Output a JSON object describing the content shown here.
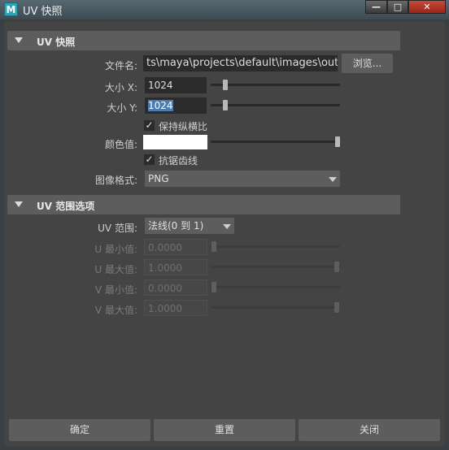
{
  "window": {
    "title": "UV 快照",
    "icon_letter": "M",
    "min": "—",
    "max": "□",
    "close": "✕"
  },
  "uv_snapshot": {
    "header": "UV 快照",
    "file_label": "文件名:",
    "file_value": "ts\\maya\\projects\\default\\images\\outUV",
    "browse": "浏览...",
    "size_x_label": "大小 X:",
    "size_x_value": "1024",
    "size_y_label": "大小 Y:",
    "size_y_value": "1024",
    "keep_aspect_label": "保持纵横比",
    "keep_aspect_checked": true,
    "color_label": "颜色值:",
    "color_value": "#ffffff",
    "color_level": 1.0,
    "antialias_label": "抗锯齿线",
    "antialias_checked": true,
    "format_label": "图像格式:",
    "format_value": "PNG",
    "size_x_level": 0.1,
    "size_y_level": 0.1
  },
  "uv_range": {
    "header": "UV 范围选项",
    "range_label": "UV 范围:",
    "range_value": "法线(0 到 1)",
    "u_min_label": "U 最小值:",
    "u_min_value": "0.0000",
    "u_max_label": "U 最大值:",
    "u_max_value": "1.0000",
    "v_min_label": "V 最小值:",
    "v_min_value": "0.0000",
    "v_max_label": "V 最大值:",
    "v_max_value": "1.0000"
  },
  "footer": {
    "ok": "确定",
    "reset": "重置",
    "close": "关闭"
  },
  "icons": {
    "check": "✓"
  }
}
